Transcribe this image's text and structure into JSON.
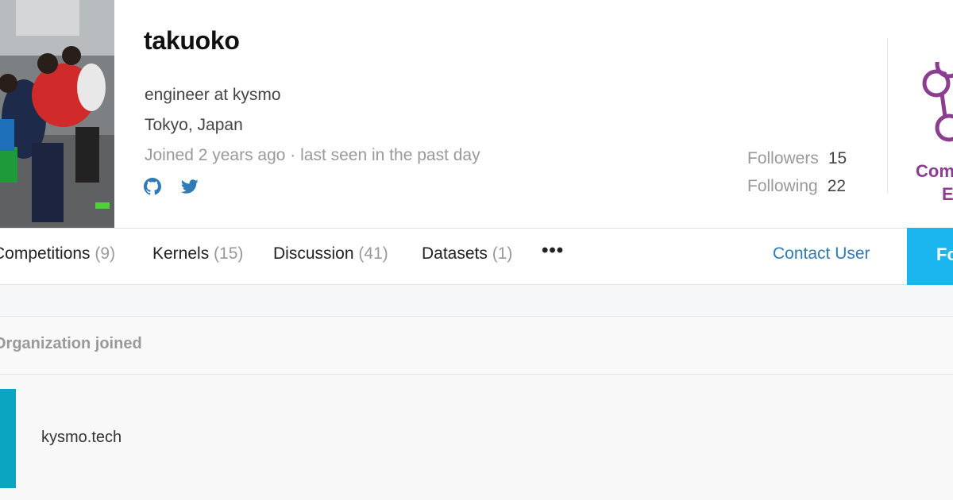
{
  "profile": {
    "username": "takuoko",
    "bio": "engineer at kysmo",
    "location": "Tokyo, Japan",
    "joined": "Joined 2 years ago · last seen in the past day",
    "social": [
      {
        "icon": "github-icon"
      },
      {
        "icon": "twitter-icon"
      }
    ],
    "followers_label": "Followers",
    "followers": "15",
    "following_label": "Following",
    "following": "22",
    "tier_line1": "Com",
    "tier_line2": "E"
  },
  "tabs": [
    {
      "label": "Competitions",
      "count": "(9)"
    },
    {
      "label": "Kernels",
      "count": "(15)"
    },
    {
      "label": "Discussion",
      "count": "(41)"
    },
    {
      "label": "Datasets",
      "count": "(1)"
    }
  ],
  "more_label": "•••",
  "contact_label": "Contact User",
  "follow_label": "Fo",
  "organizations": {
    "title": "Organization joined",
    "items": [
      {
        "name": "kysmo.tech"
      }
    ]
  },
  "colors": {
    "accent": "#1bb5f0",
    "link": "#2e7bb8",
    "tier": "#8b3e8f",
    "org_logo": "#0ba5c2"
  }
}
